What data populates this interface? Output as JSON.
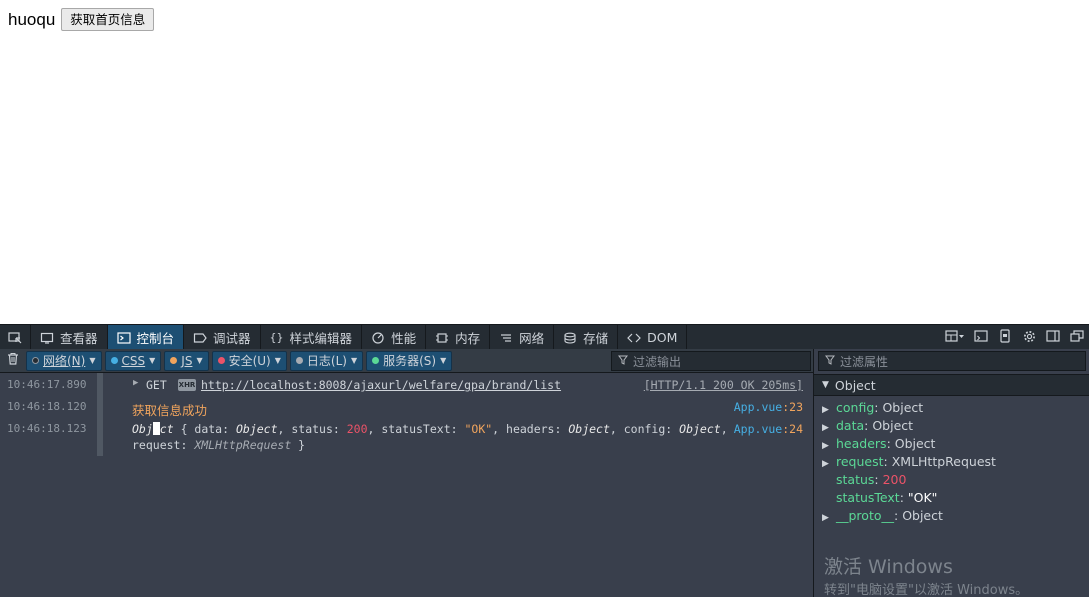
{
  "page": {
    "title": "huoqu",
    "button_label": "获取首页信息"
  },
  "devtools": {
    "tabs": [
      {
        "label": "查看器",
        "icon": "inspector-icon"
      },
      {
        "label": "控制台",
        "icon": "console-icon",
        "active": true
      },
      {
        "label": "调试器",
        "icon": "debugger-icon"
      },
      {
        "label": "样式编辑器",
        "icon": "style-editor-icon"
      },
      {
        "label": "性能",
        "icon": "performance-icon"
      },
      {
        "label": "内存",
        "icon": "memory-icon"
      },
      {
        "label": "网络",
        "icon": "network-icon"
      },
      {
        "label": "存储",
        "icon": "storage-icon"
      },
      {
        "label": "DOM",
        "icon": "dom-icon"
      }
    ],
    "filters": [
      {
        "label": "网络(N)",
        "color": "#252c33"
      },
      {
        "label": "CSS",
        "color": "#46afe3"
      },
      {
        "label": "JS",
        "color": "#f0a45d"
      },
      {
        "label": "安全(U)",
        "color": "#eb5368"
      },
      {
        "label": "日志(L)",
        "color": "#a6abb2"
      },
      {
        "label": "服务器(S)",
        "color": "#5bd896"
      }
    ],
    "filter_placeholder": "过滤输出",
    "messages": [
      {
        "time": "10:46:17.890",
        "method": "GET",
        "badge": "XHR",
        "url": "http://localhost:8008/ajaxurl/welfare/gpa/brand/list",
        "status": "[HTTP/1.1 200 OK 205ms]"
      },
      {
        "time": "10:46:18.120",
        "text": "获取信息成功",
        "source": "App.vue",
        "line": ":23"
      },
      {
        "time": "10:46:18.123",
        "source": "App.vue",
        "line": ":24"
      }
    ],
    "object_line": {
      "obj_a": "Obj",
      "obj_b": "ct",
      "brace_open": " { data: ",
      "data_val": "Object",
      "status_key": ", status: ",
      "status_val": "200",
      "statustext_key": ", statusText: ",
      "statustext_val": "\"OK\"",
      "headers_key": ", headers: ",
      "headers_val": "Object",
      "config_key": ", config: ",
      "config_val": "Object",
      "comma": ",",
      "request_key": "request: ",
      "request_val": "XMLHttpRequest",
      "brace_close": " }"
    },
    "side": {
      "filter_placeholder": "过滤属性",
      "head": "Object",
      "props": [
        {
          "key": "config",
          "sep": ": ",
          "value": "Object",
          "expandable": true,
          "type": "obj"
        },
        {
          "key": "data",
          "sep": ": ",
          "value": "Object",
          "expandable": true,
          "type": "obj"
        },
        {
          "key": "headers",
          "sep": ": ",
          "value": "Object",
          "expandable": true,
          "type": "obj"
        },
        {
          "key": "request",
          "sep": ": ",
          "value": "XMLHttpRequest",
          "expandable": true,
          "type": "obj"
        },
        {
          "key": "status",
          "sep": ": ",
          "value": "200",
          "expandable": false,
          "type": "num"
        },
        {
          "key": "statusText",
          "sep": ": ",
          "value": "\"OK\"",
          "expandable": false,
          "type": "str"
        },
        {
          "key": "__proto__",
          "sep": ": ",
          "value": "Object",
          "expandable": true,
          "type": "obj"
        }
      ],
      "watermark_title": "激活 Windows",
      "watermark_sub": "转到\"电脑设置\"以激活 Windows。"
    }
  }
}
